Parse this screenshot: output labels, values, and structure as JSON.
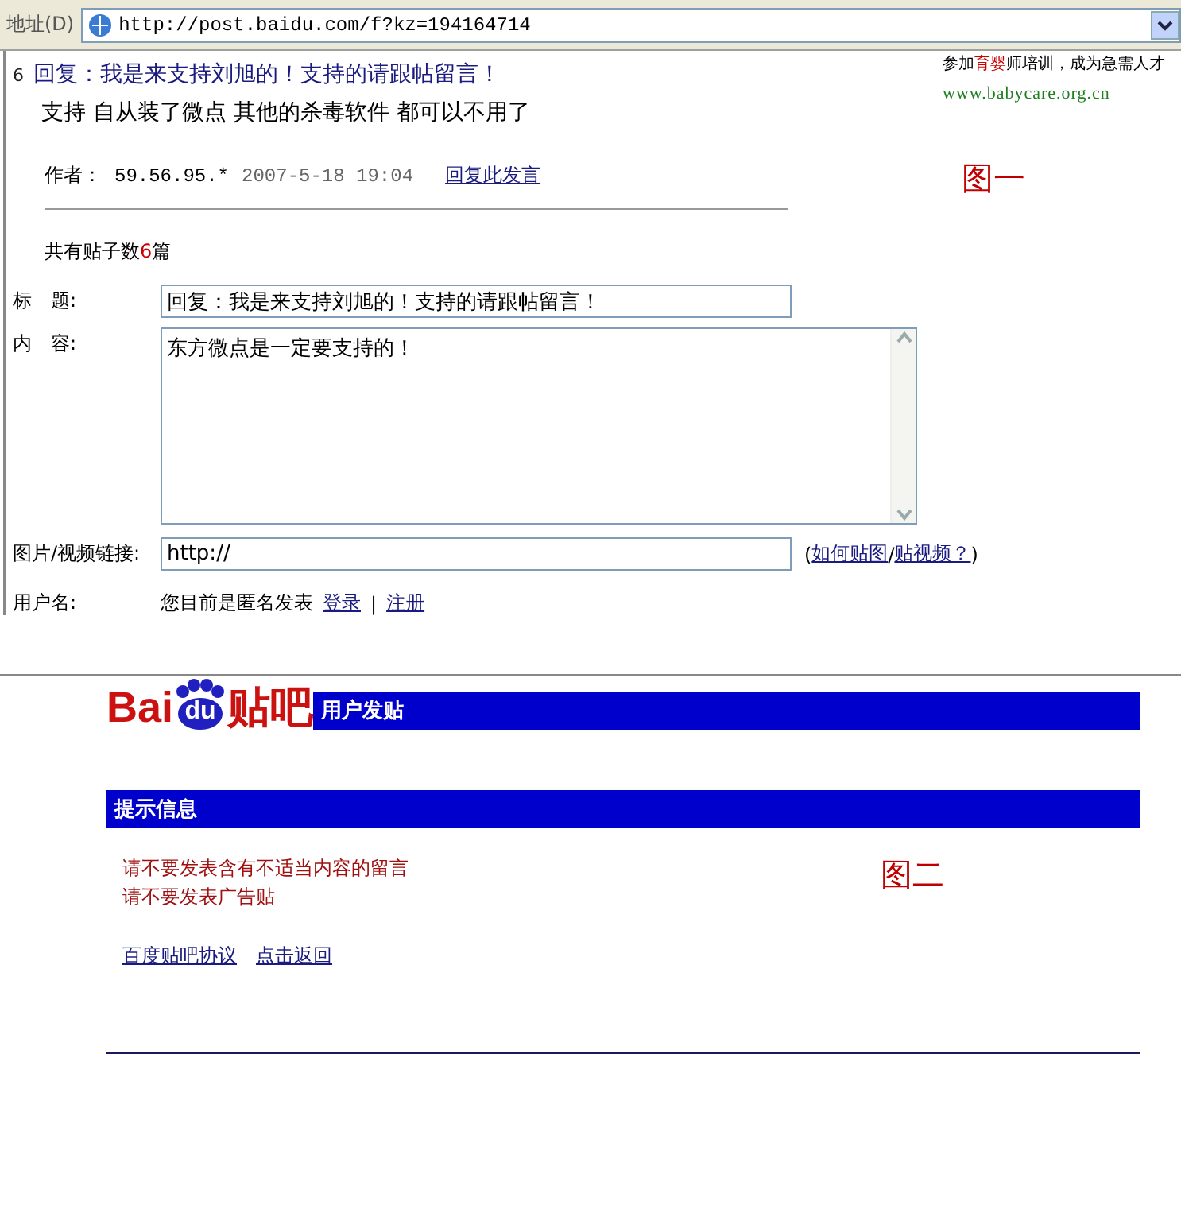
{
  "address_bar": {
    "label": "地址",
    "shortcut": "(D)",
    "url": "http://post.baidu.com/f?kz=194164714"
  },
  "ad": {
    "segments": [
      {
        "text": "参加",
        "kind": "plain"
      },
      {
        "text": "育婴",
        "kind": "highlight"
      },
      {
        "text": "师培训，成为急需人才",
        "kind": "plain"
      }
    ],
    "link": "www.babycare.org.cn"
  },
  "post": {
    "number": "6",
    "title": "回复：我是来支持刘旭的！支持的请跟帖留言！",
    "body": "支持 自从装了微点 其他的杀毒软件 都可以不用了",
    "author_label": "作者：",
    "author": "59.56.95.*",
    "time": "2007-5-18 19:04",
    "reply_link": "回复此发言"
  },
  "figure_labels": [
    "图一",
    "图二"
  ],
  "post_count": {
    "prefix": "共有贴子数",
    "count": "6",
    "suffix": "篇"
  },
  "form": {
    "title_label": "标　题:",
    "title_value": "回复：我是来支持刘旭的！支持的请跟帖留言！",
    "content_label": "内　容:",
    "content_value": "东方微点是一定要支持的！",
    "link_label": "图片/视频链接:",
    "link_value": "http://",
    "help_open": "(",
    "help_links": [
      "如何贴图",
      "贴视频？"
    ],
    "help_sep": "/",
    "help_close": ")",
    "user_label": "用户名:",
    "user_text": "您目前是匿名发表",
    "login": "登录",
    "sep": "|",
    "register": "注册"
  },
  "logo": {
    "left": "Bai",
    "paw": "du",
    "right": "贴吧"
  },
  "header_bar": "用户发贴",
  "notice": {
    "title": "提示信息",
    "messages": [
      "请不要发表含有不适当内容的留言",
      "请不要发表广告贴"
    ],
    "links": [
      "百度贴吧协议",
      "点击返回"
    ]
  }
}
